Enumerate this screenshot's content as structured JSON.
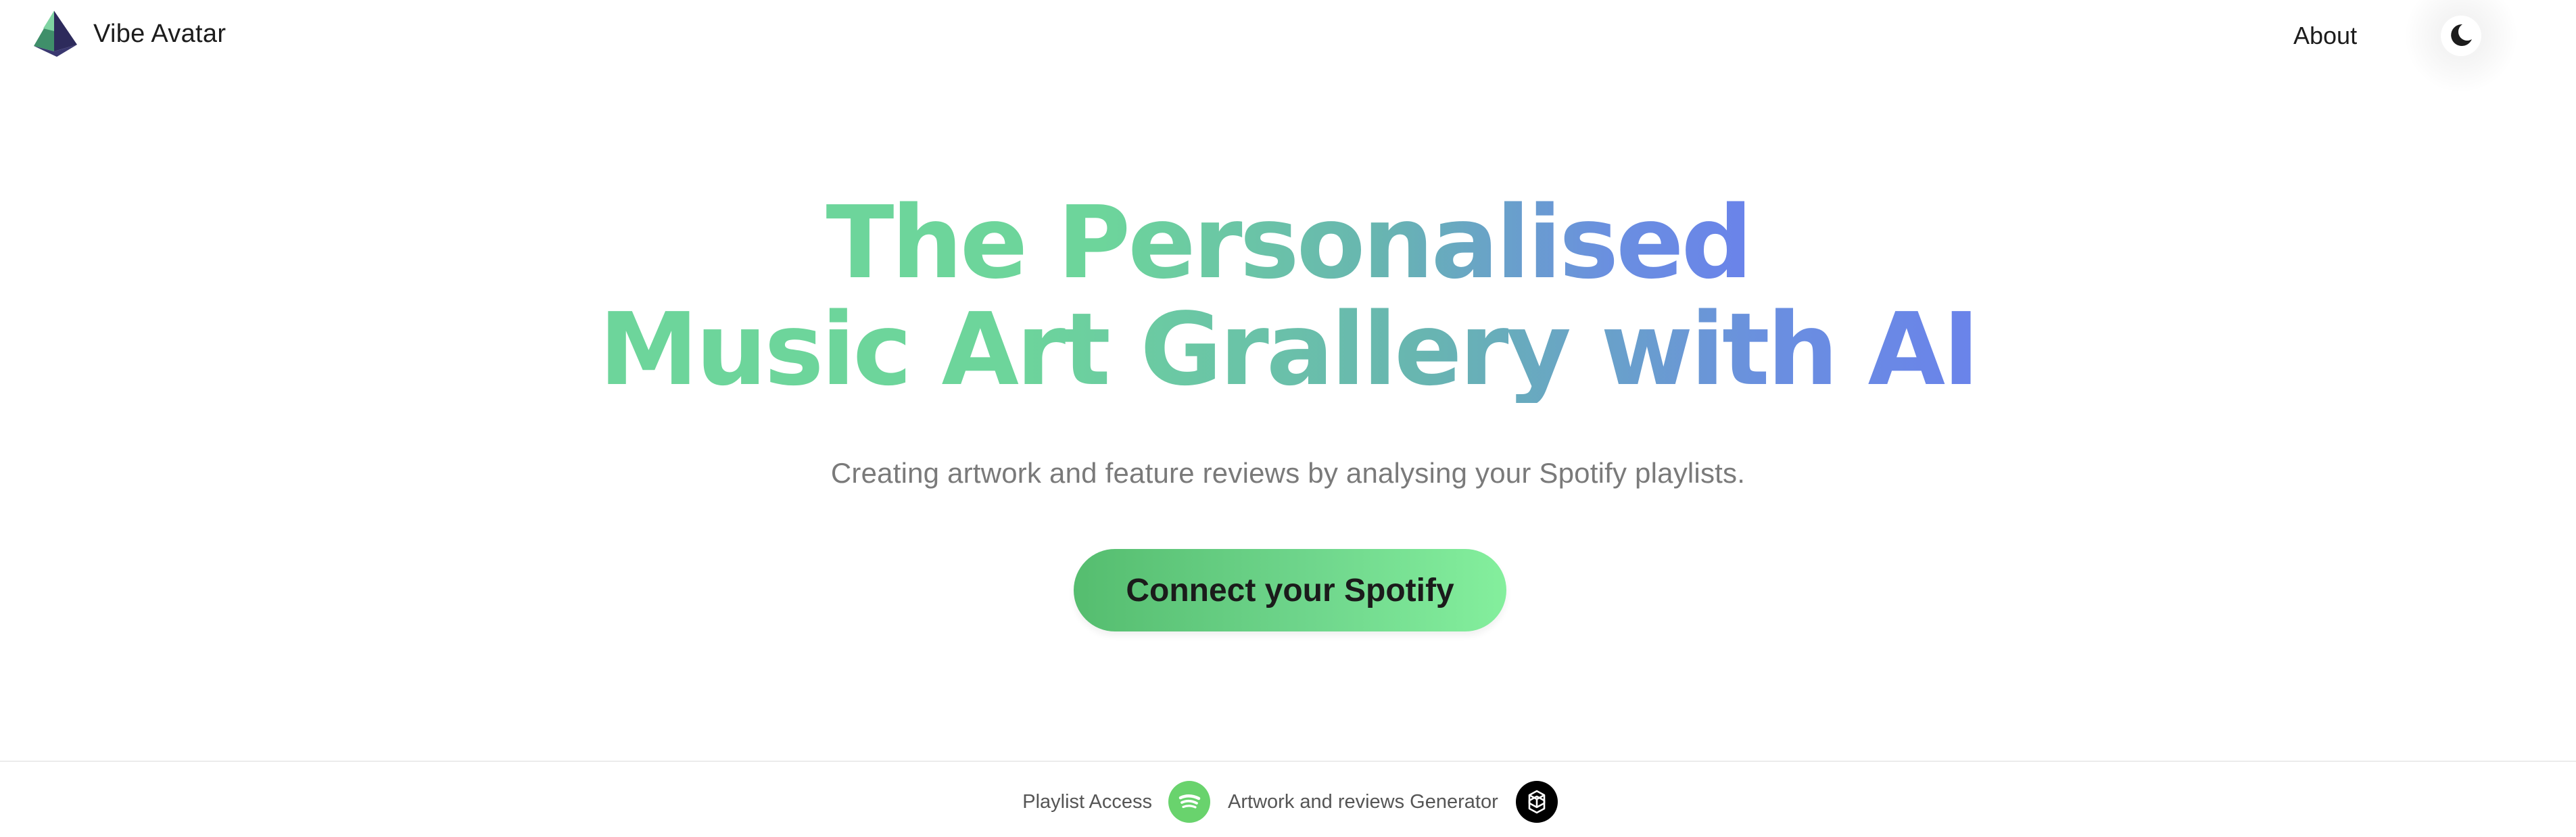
{
  "header": {
    "logo_text": "Vibe Avatar",
    "logo_icon": "pyramid-icon",
    "about_label": "About",
    "theme_icon": "moon-icon"
  },
  "hero": {
    "title_line1": "The Personalised",
    "title_line2": "Music Art Grallery with AI",
    "subtitle": "Creating artwork and feature reviews by analysing your Spotify playlists.",
    "connect_label": "Connect your Spotify"
  },
  "footer": {
    "playlist_label": "Playlist Access",
    "playlist_icon": "spotify-icon",
    "generator_label": "Artwork and reviews Generator",
    "generator_icon": "openai-icon"
  },
  "colors": {
    "gradient_green": "#6dd59b",
    "gradient_blue": "#6a83ea",
    "button_green": "#6fd68c",
    "spotify_green": "#69d36d"
  }
}
